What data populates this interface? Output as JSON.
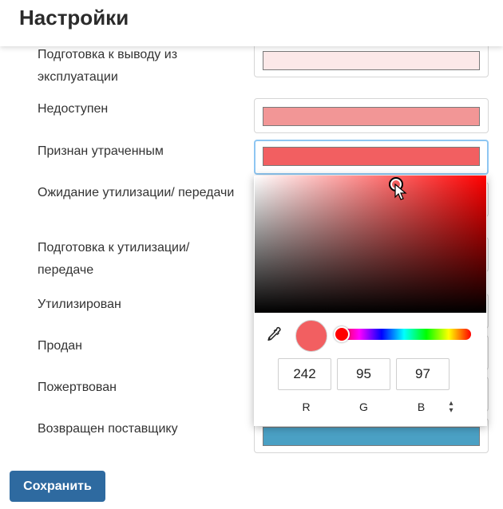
{
  "header": {
    "title": "Настройки"
  },
  "rows": [
    {
      "label": "Подготовка к выводу из эксплуатации",
      "color": "#fce8e8"
    },
    {
      "label": "Недоступен",
      "color": "#f29696"
    },
    {
      "label": "Признан утраченным",
      "color": "#f25f61"
    },
    {
      "label": "Ожидание утилизации/ передачи",
      "color": ""
    },
    {
      "label": "Подготовка к утилизации/ передаче",
      "color": ""
    },
    {
      "label": "Утилизирован",
      "color": ""
    },
    {
      "label": "Продан",
      "color": ""
    },
    {
      "label": "Пожертвован",
      "color": ""
    },
    {
      "label": "Возвращен поставщику",
      "color": "#4aa0c4"
    }
  ],
  "picker": {
    "hue_color": "#ff0000",
    "preview_color": "#f25f61",
    "r": "242",
    "g": "95",
    "b": "97",
    "r_label": "R",
    "g_label": "G",
    "b_label": "B",
    "mode_toggle_icon": "up-down-arrows-icon",
    "eyedropper_icon": "eyedropper-icon"
  },
  "footer": {
    "save_label": "Сохранить",
    "save_color": "#2e6aa0"
  }
}
